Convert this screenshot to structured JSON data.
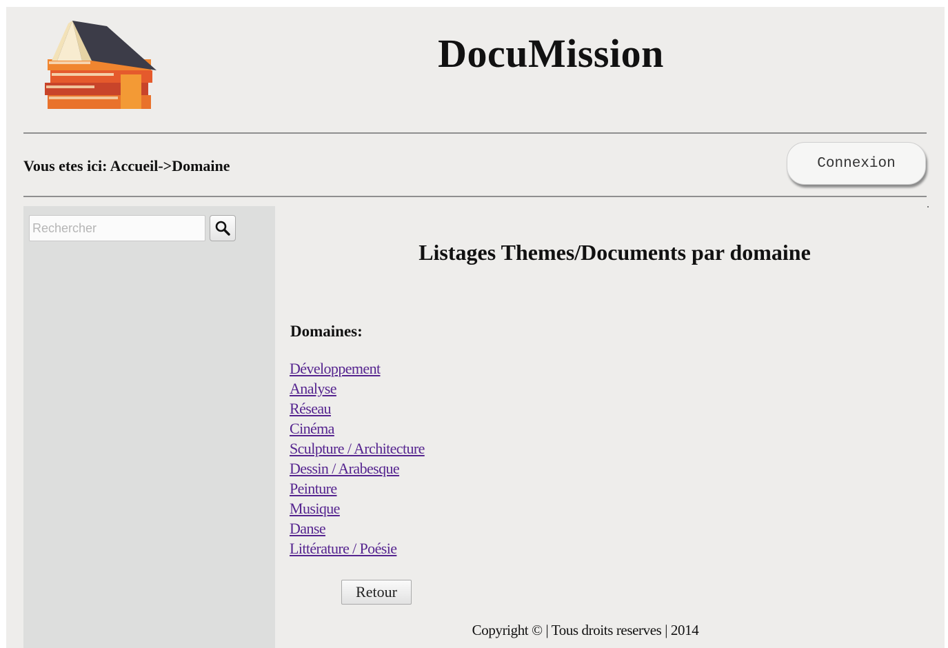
{
  "header": {
    "site_title": "DocuMission"
  },
  "breadcrumb": {
    "text": "Vous etes ici: Accueil->Domaine"
  },
  "auth": {
    "login_label": "Connexion"
  },
  "sidebar": {
    "search_placeholder": "Rechercher",
    "search_value": "",
    "search_button_icon": "search-icon"
  },
  "main": {
    "title": "Listages Themes/Documents par domaine",
    "domains_label": "Domaines:",
    "domains": [
      "Développement",
      "Analyse",
      "Réseau",
      "Cinéma",
      "Sculpture / Architecture",
      "Dessin / Arabesque",
      "Peinture",
      "Musique",
      "Danse",
      "Littérature / Poésie"
    ],
    "back_label": "Retour"
  },
  "footer": {
    "text": "Copyright © | Tous droits reserves | 2014"
  },
  "colors": {
    "page_background": "#eeedeb",
    "sidebar_background": "#dddedd",
    "link": "#55248f",
    "logo_roof": "#3c3c48",
    "logo_books": "#e8562a"
  }
}
